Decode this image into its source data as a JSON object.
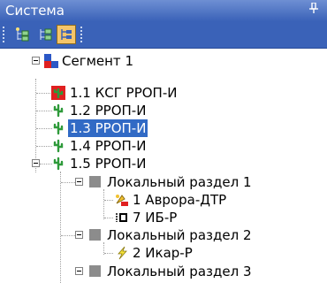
{
  "panel": {
    "title": "Система",
    "pin_glyph": "ꟷ"
  },
  "toolbar": {
    "buttons": [
      {
        "name": "tree-expand-icon",
        "active": false
      },
      {
        "name": "tree-collapse-icon",
        "active": false
      },
      {
        "name": "tree-view-icon",
        "active": true
      }
    ]
  },
  "tree": {
    "root": "Сегмент 1",
    "items": [
      "1.1 КСГ РРОП-И",
      "1.2 РРОП-И",
      "1.3 РРОП-И",
      "1.4 РРОП-И",
      "1.5 РРОП-И"
    ],
    "sections": [
      {
        "label": "Локальный раздел 1",
        "children": [
          "1 Аврора-ДТР",
          "7 ИБ-Р"
        ]
      },
      {
        "label": "Локальный раздел 2",
        "children": [
          "2 Икар-Р"
        ]
      },
      {
        "label": "Локальный раздел 3"
      }
    ],
    "selected_index": 2
  },
  "colors": {
    "titlebar": "#3a62b8",
    "selection": "#316ac5",
    "cactus_green": "#2e9a3a",
    "alarm_red": "#e02020"
  }
}
